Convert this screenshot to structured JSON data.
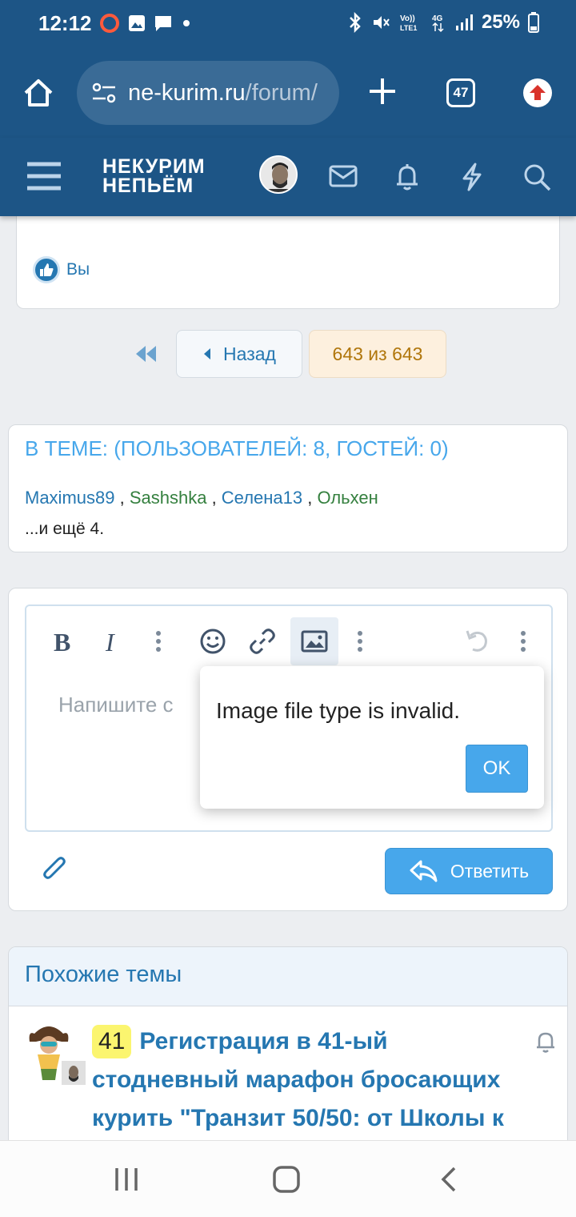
{
  "status_bar": {
    "time": "12:12",
    "battery": "25%"
  },
  "browser": {
    "url_domain": "ne-kurim.ru",
    "url_path": "/forum/",
    "tab_count": "47"
  },
  "site": {
    "logo_line1": "НЕКУРИМ",
    "logo_line2": "НЕПЬЁМ"
  },
  "reactions": {
    "label": "Вы"
  },
  "pagination": {
    "back_label": "Назад",
    "page_label": "643 из 643"
  },
  "online": {
    "title": "В ТЕМЕ: (ПОЛЬЗОВАТЕЛЕЙ: 8, ГОСТЕЙ: 0)",
    "users": [
      {
        "name": "Maximus89",
        "color": "#2577b1"
      },
      {
        "name": "Sashshka",
        "color": "#35803f"
      },
      {
        "name": "Селена13",
        "color": "#2577b1"
      },
      {
        "name": "Ольхен",
        "color": "#35803f"
      }
    ],
    "separator": " , ",
    "more": "...и ещё 4."
  },
  "editor": {
    "placeholder": "Напишите с",
    "reply_label": "Ответить"
  },
  "dialog": {
    "message": "Image file type is invalid.",
    "ok_label": "OK"
  },
  "similar": {
    "title": "Похожие темы",
    "thread_badge": "41",
    "thread_title": "Регистрация в 41-ый стодневный марафон бросающих курить \"Транзит 50/50: от Школы к"
  },
  "colors": {
    "header_bg": "#1d5586",
    "accent": "#47a7eb",
    "link": "#2577b1"
  }
}
